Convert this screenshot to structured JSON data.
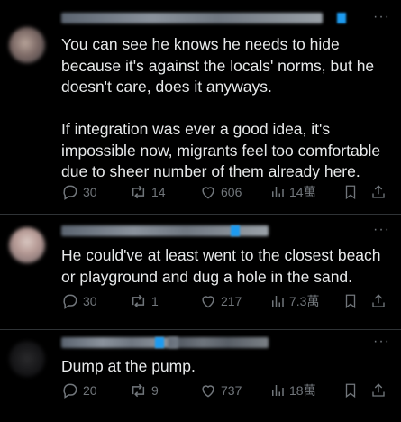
{
  "replies": [
    {
      "text": "You can see he knows he needs to hide because it's against the locals' norms, but he doesn't care, does it anyways.\n\nIf integration was ever a good idea, it's impossible now, migrants feel too comfortable due to sheer number of them already here.",
      "more": "···",
      "stats": {
        "replies": "30",
        "reposts": "14",
        "likes": "606",
        "views": "14萬"
      }
    },
    {
      "text": "He could've at least went to the closest beach or playground and dug a hole in the sand.",
      "more": "···",
      "stats": {
        "replies": "30",
        "reposts": "1",
        "likes": "217",
        "views": "7.3萬"
      }
    },
    {
      "text": "Dump at the pump.",
      "more": "···",
      "stats": {
        "replies": "20",
        "reposts": "9",
        "likes": "737",
        "views": "18萬"
      }
    }
  ],
  "icons": {
    "reply": "reply-icon",
    "repost": "repost-icon",
    "like": "heart-icon",
    "views": "views-icon",
    "bookmark": "bookmark-icon",
    "share": "share-icon"
  },
  "colors": {
    "background": "#000000",
    "text": "#e7e9ea",
    "muted": "#71767b",
    "divider": "#2f3336",
    "verified": "#1d9bf0"
  }
}
